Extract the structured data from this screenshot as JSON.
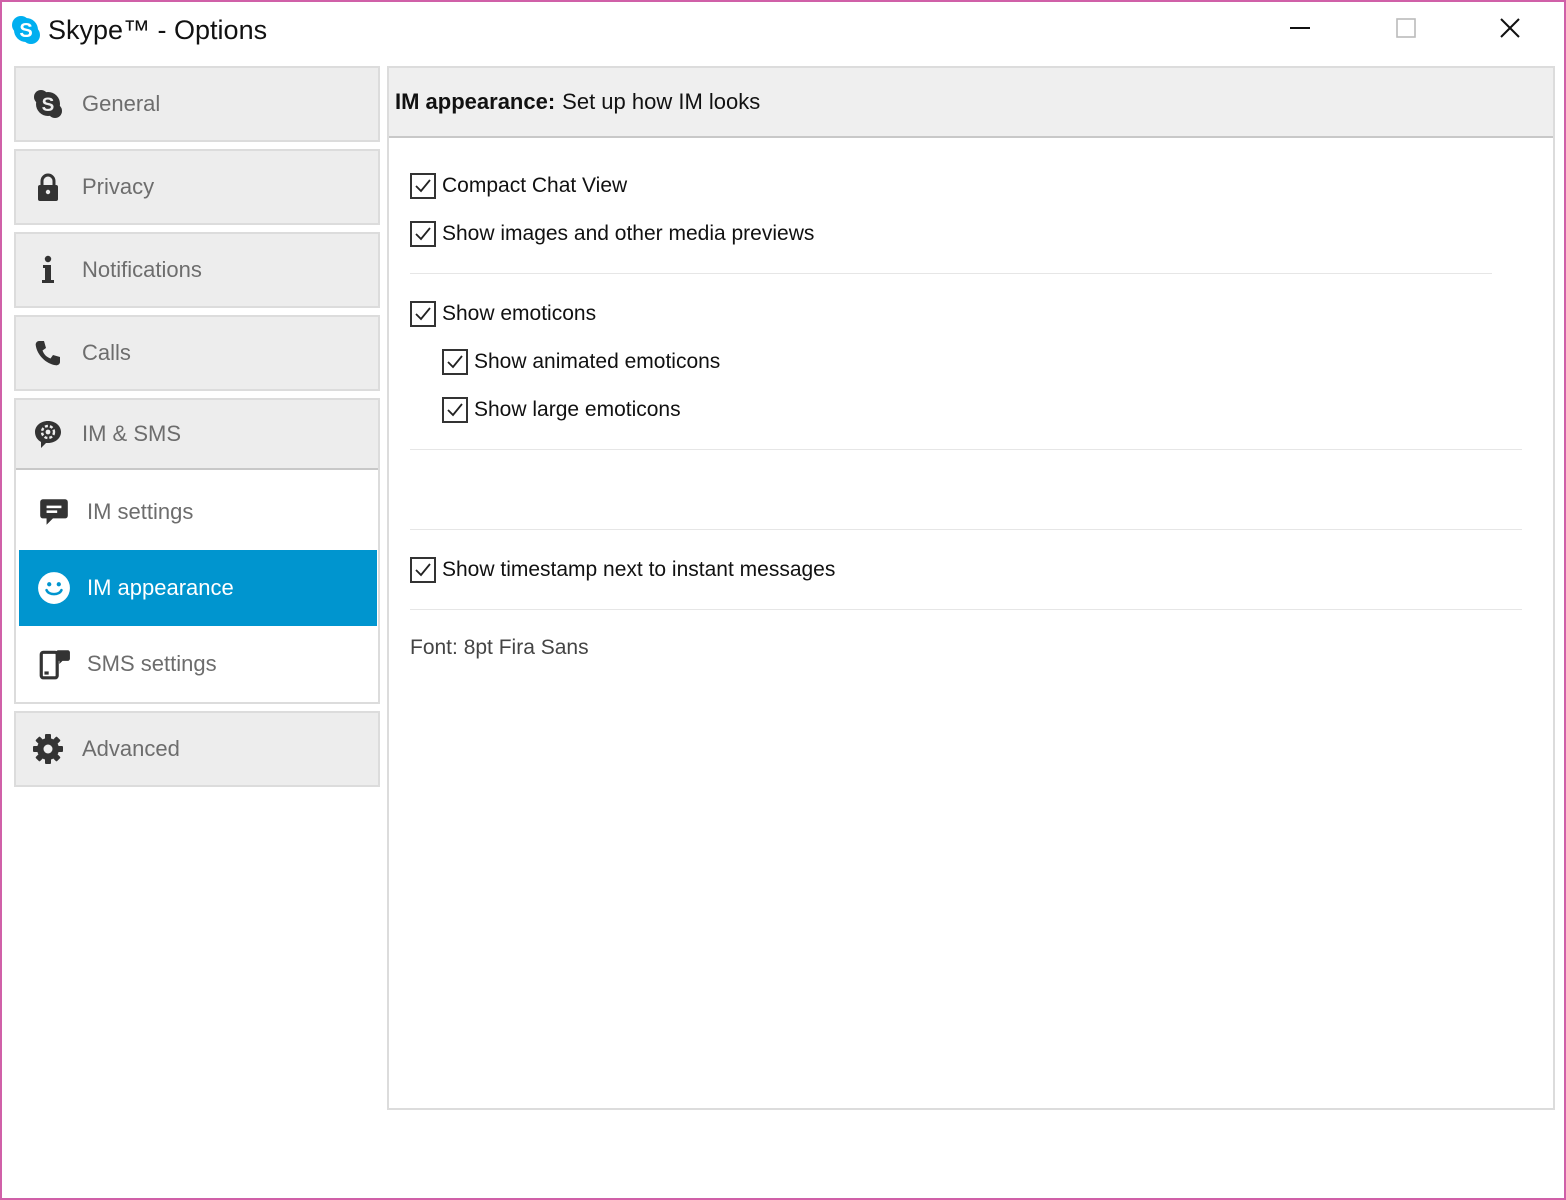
{
  "window": {
    "title": "Skype™ - Options",
    "app_icon": "skype-logo-icon",
    "controls": {
      "minimize": "minimize-icon",
      "maximize": "maximize-icon",
      "close": "close-icon"
    }
  },
  "sidebar": {
    "items": [
      {
        "id": "general",
        "label": "General",
        "icon": "skype-icon"
      },
      {
        "id": "privacy",
        "label": "Privacy",
        "icon": "lock-icon"
      },
      {
        "id": "notifications",
        "label": "Notifications",
        "icon": "info-icon"
      },
      {
        "id": "calls",
        "label": "Calls",
        "icon": "phone-icon"
      },
      {
        "id": "im-sms",
        "label": "IM & SMS",
        "icon": "chat-gear-icon"
      },
      {
        "id": "advanced",
        "label": "Advanced",
        "icon": "gear-icon"
      }
    ],
    "im_sub_items": [
      {
        "id": "im-settings",
        "label": "IM settings",
        "icon": "chat-bubble-icon",
        "active": false
      },
      {
        "id": "im-appearance",
        "label": "IM appearance",
        "icon": "smiley-icon",
        "active": true
      },
      {
        "id": "sms-settings",
        "label": "SMS settings",
        "icon": "mobile-message-icon",
        "active": false
      }
    ]
  },
  "content": {
    "header_bold": "IM appearance:",
    "header_text": "Set up how IM looks",
    "options": {
      "compact_chat_view": {
        "label": "Compact Chat View",
        "checked": true
      },
      "show_media_previews": {
        "label": "Show images and other media previews",
        "checked": true
      },
      "show_emoticons": {
        "label": "Show emoticons",
        "checked": true
      },
      "show_animated_emoticons": {
        "label": "Show animated emoticons",
        "checked": true
      },
      "show_large_emoticons": {
        "label": "Show large emoticons",
        "checked": true
      },
      "show_timestamp": {
        "label": "Show timestamp next to instant messages",
        "checked": true
      }
    },
    "font_info": "Font: 8pt Fira Sans"
  },
  "colors": {
    "accent": "#0095cf",
    "skype_blue": "#00aff0",
    "nav_bg": "#ededed",
    "border": "#dcdcdc"
  }
}
